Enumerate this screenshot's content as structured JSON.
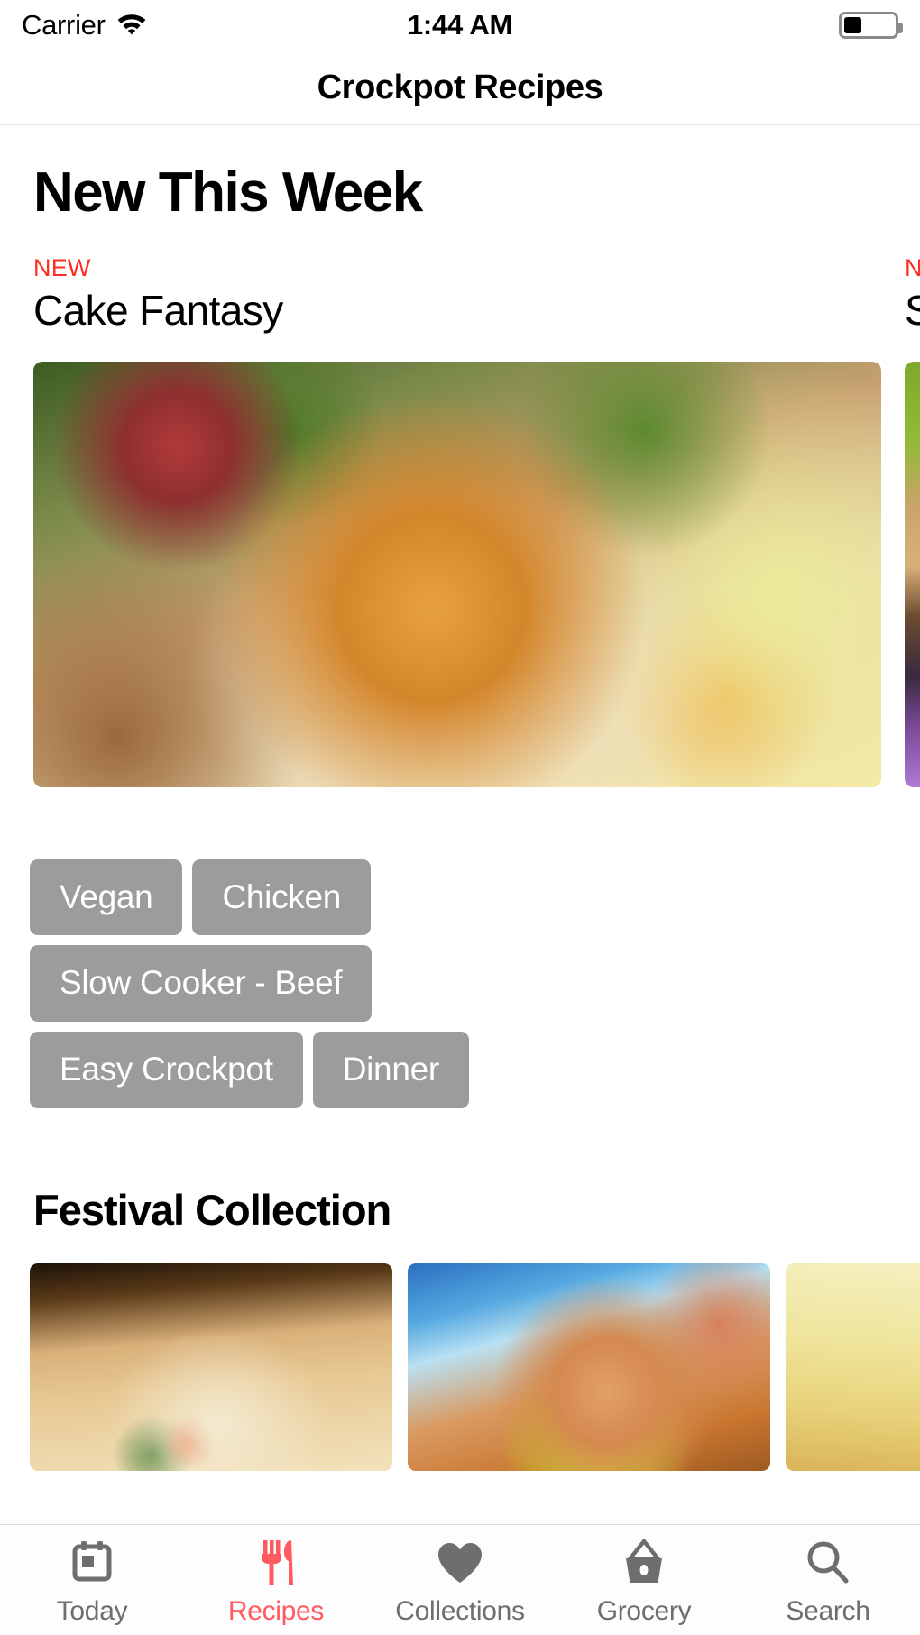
{
  "status_bar": {
    "carrier": "Carrier",
    "wifi_icon": "wifi-icon",
    "time": "1:44 AM",
    "battery_icon": "battery-icon",
    "battery_level_pct": 36
  },
  "nav": {
    "title": "Crockpot Recipes"
  },
  "sections": [
    {
      "title": "New This Week",
      "cards": [
        {
          "badge": "NEW",
          "name": "Cake Fantasy",
          "image": "apple-cake-photo"
        },
        {
          "badge": "NEW",
          "name": "S",
          "image": "vegetable-stack-photo"
        }
      ]
    },
    {
      "title": "Festival Collection",
      "cards": [
        {
          "image": "noodle-salad-photo"
        },
        {
          "image": "clay-pot-chicken-photo"
        },
        {
          "image": "third-recipe-photo"
        }
      ]
    }
  ],
  "tags": [
    "Vegan",
    "Chicken",
    "Slow Cooker - Beef",
    "Easy Crockpot",
    "Dinner"
  ],
  "tab_bar": {
    "items": [
      {
        "label": "Today",
        "icon": "calendar-icon",
        "active": false
      },
      {
        "label": "Recipes",
        "icon": "fork-knife-icon",
        "active": true
      },
      {
        "label": "Collections",
        "icon": "heart-icon",
        "active": false
      },
      {
        "label": "Grocery",
        "icon": "basket-icon",
        "active": false
      },
      {
        "label": "Search",
        "icon": "magnifier-icon",
        "active": false
      }
    ]
  },
  "colors": {
    "accent": "#ff5a5f",
    "badge_new": "#ff2d1f",
    "tag_background": "#9c9c9c",
    "tab_inactive": "#6e6e6e",
    "separator": "#e3e3e3"
  }
}
